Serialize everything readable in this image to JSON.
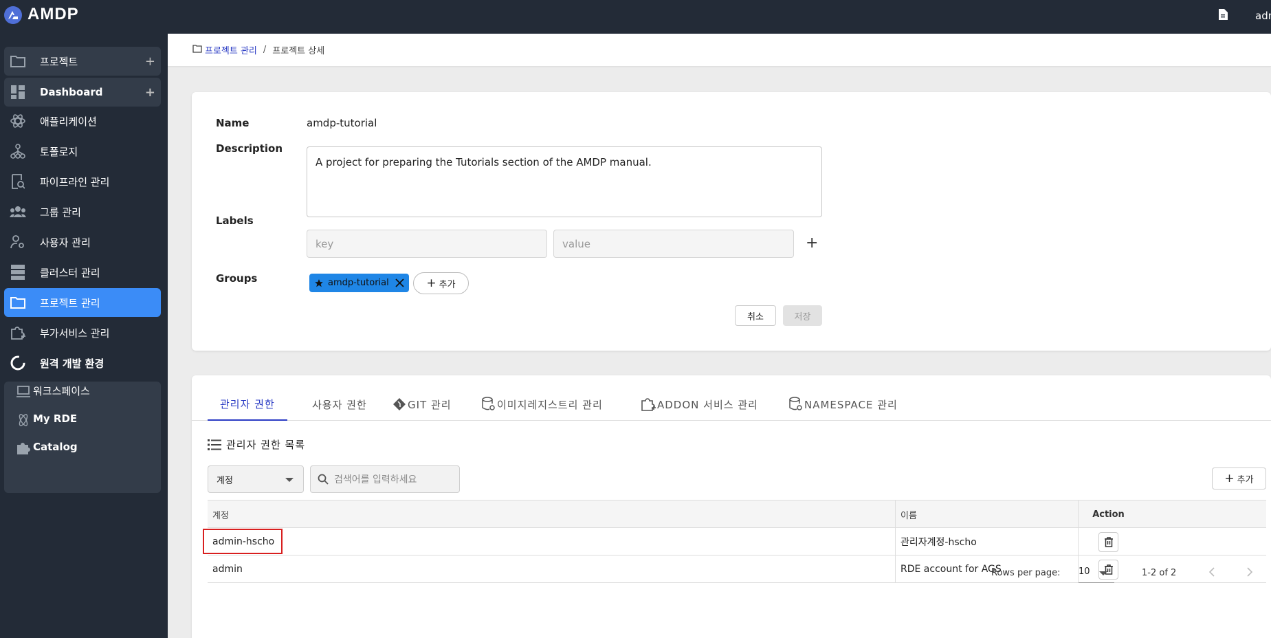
{
  "app": {
    "name": "AMDP",
    "user": "adm"
  },
  "sidebar": {
    "items": [
      {
        "label": "프로젝트",
        "icon": "folder-icon"
      },
      {
        "label": "Dashboard",
        "icon": "dashboard-icon"
      },
      {
        "label": "애플리케이션",
        "icon": "atom-icon"
      },
      {
        "label": "토폴로지",
        "icon": "hierarchy-icon"
      },
      {
        "label": "파이프라인 관리",
        "icon": "pipeline-icon"
      },
      {
        "label": "그룹 관리",
        "icon": "group-icon"
      },
      {
        "label": "사용자 관리",
        "icon": "user-gear-icon"
      },
      {
        "label": "클러스터 관리",
        "icon": "server-icon"
      },
      {
        "label": "프로젝트 관리",
        "icon": "folder-icon"
      },
      {
        "label": "부가서비스 관리",
        "icon": "puzzle-plus-icon"
      },
      {
        "label": "원격 개발 환경",
        "icon": "loading-ring-icon"
      },
      {
        "label": "워크스페이스",
        "icon": "laptop-icon"
      },
      {
        "label": "My RDE",
        "icon": "atom-icon"
      },
      {
        "label": "Catalog",
        "icon": "puzzle-icon"
      }
    ],
    "plus": "+"
  },
  "breadcrumb": {
    "parent": "프로젝트 관리",
    "separator": "/",
    "current": "프로젝트 상세"
  },
  "project": {
    "name_label": "Name",
    "name_value": "amdp-tutorial",
    "desc_label": "Description",
    "desc_value": "A project for preparing the Tutorials section of the AMDP manual.",
    "labels_label": "Labels",
    "key_placeholder": "key",
    "value_placeholder": "value",
    "add_symbol": "+",
    "groups_label": "Groups",
    "group_chip": "amdp-tutorial",
    "add_group": "추가",
    "cancel": "취소",
    "save": "저장"
  },
  "tabs": [
    "관리자 권한",
    "사용자 권한",
    "GIT 관리",
    "이미지레지스트리 관리",
    "ADDON 서비스 관리",
    "NAMESPACE 관리"
  ],
  "list": {
    "title": "관리자 권한 목록",
    "filter": "계정",
    "search_placeholder": "검색어를 입력하세요",
    "add": "추가",
    "columns": [
      "계정",
      "이름",
      "Action"
    ],
    "rows": [
      {
        "account": "admin-hscho",
        "name": "관리자계정-hscho"
      },
      {
        "account": "admin",
        "name": "RDE account for AGS"
      }
    ]
  },
  "pagination": {
    "rows_label": "Rows per page:",
    "rows_value": "10",
    "range": "1-2 of 2"
  }
}
